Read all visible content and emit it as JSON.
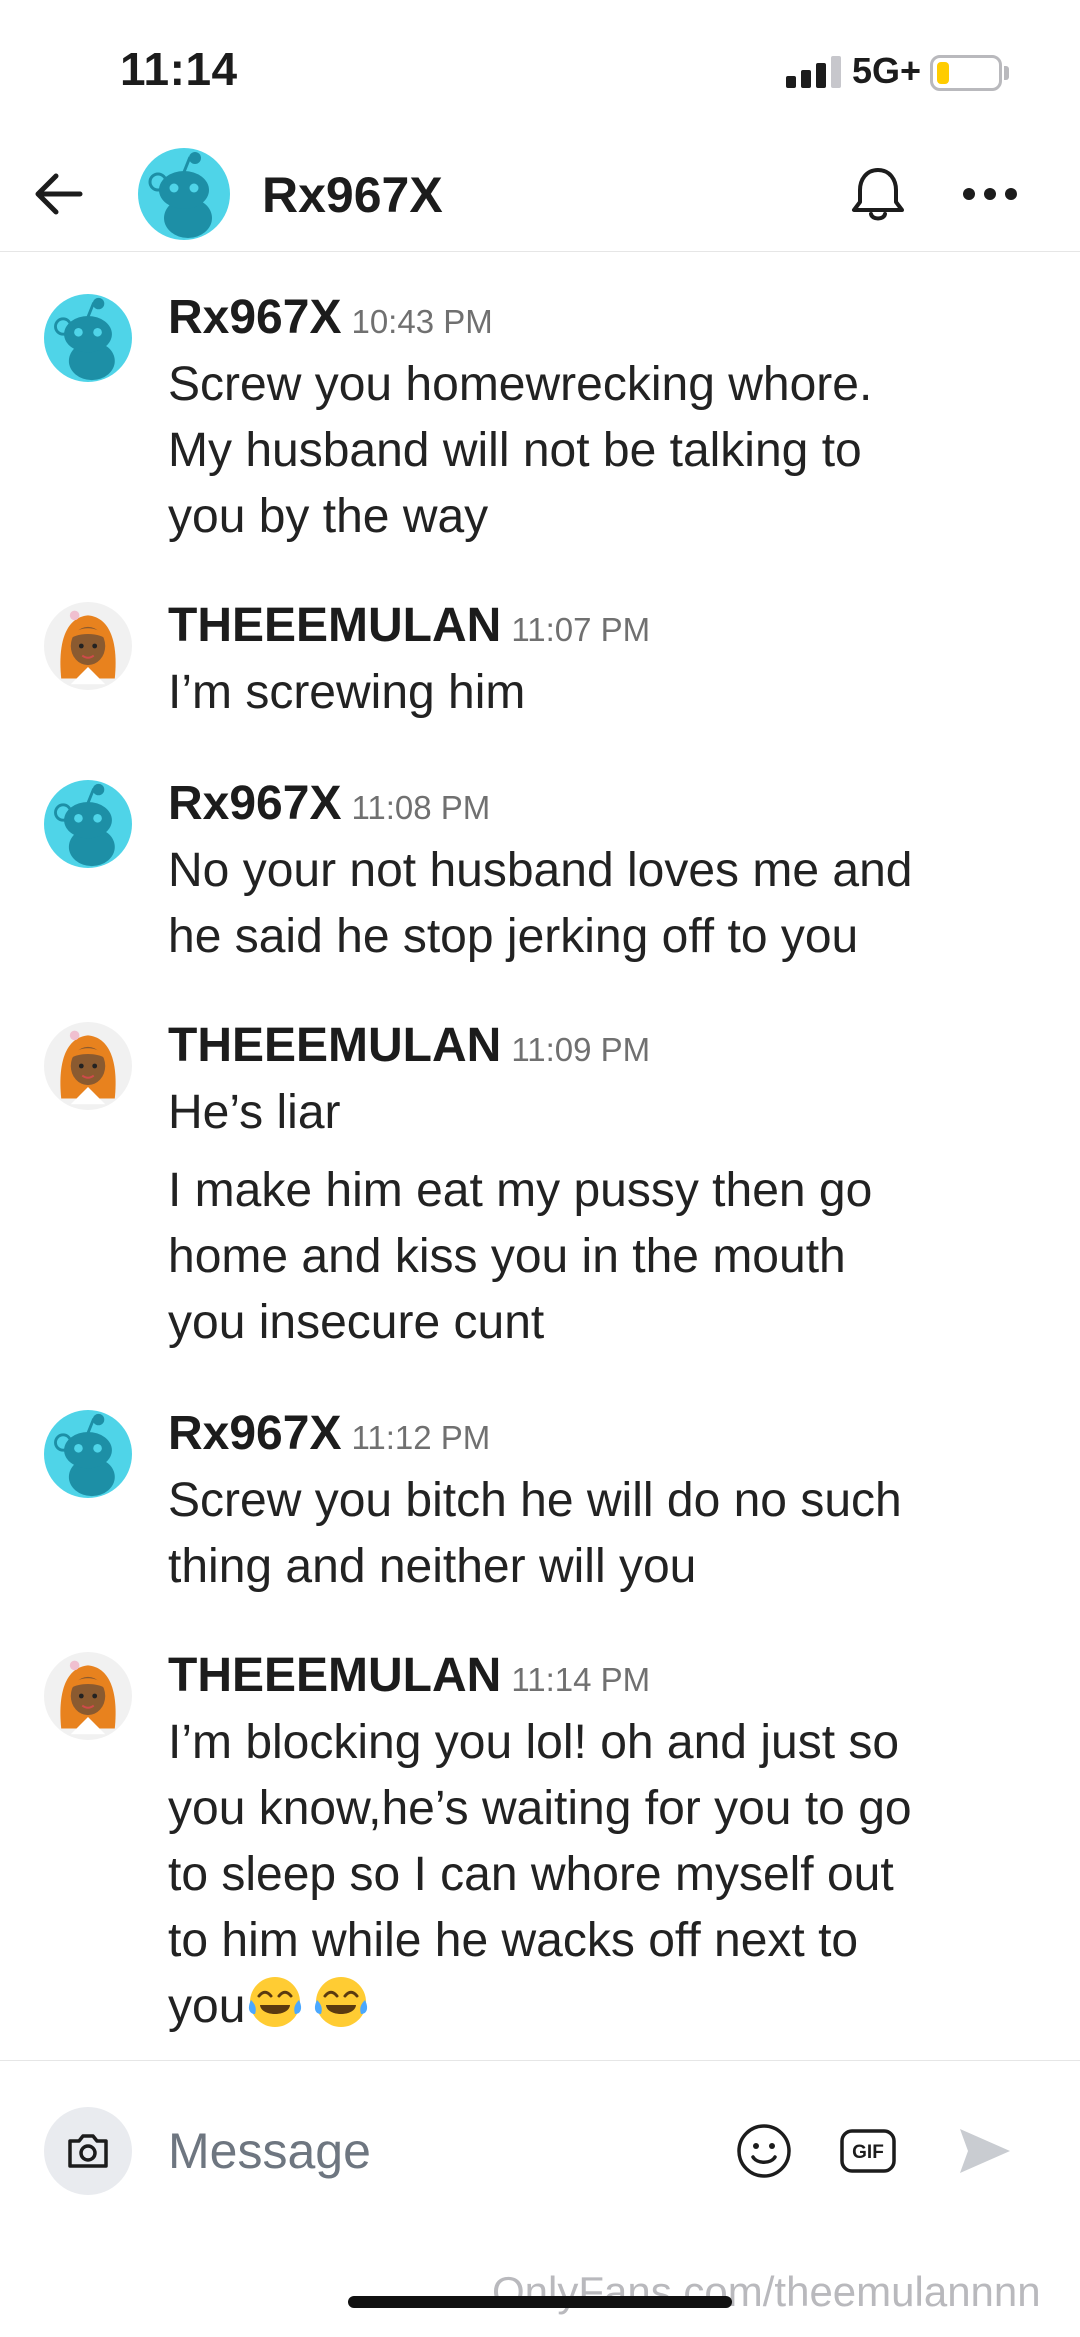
{
  "status_bar": {
    "time": "11:14",
    "network": "5G+",
    "signal_bars": 4,
    "signal_active": 3,
    "battery_level": 0.15,
    "battery_color": "#ffcc00"
  },
  "header": {
    "title": "Rx967X",
    "back_icon": "arrow-left-icon",
    "bell_icon": "bell-icon",
    "more_icon": "more-horizontal-icon"
  },
  "colors": {
    "reddit_avatar_bg": "#4fd4e8",
    "text_primary": "#1c1c1c",
    "text_secondary": "#707070"
  },
  "messages": [
    {
      "author": "Rx967X",
      "time": "10:43 PM",
      "avatar": "snoo-avatar",
      "texts": [
        "Screw you homewrecking whore.\nMy husband will not be talking to\nyou by the way"
      ]
    },
    {
      "author": "THEEEMULAN",
      "time": "11:07 PM",
      "avatar": "mulan-avatar",
      "texts": [
        "I’m screwing him"
      ]
    },
    {
      "author": "Rx967X",
      "time": "11:08 PM",
      "avatar": "snoo-avatar",
      "texts": [
        "No your not husband loves me and\nhe said he stop jerking off to you"
      ]
    },
    {
      "author": "THEEEMULAN",
      "time": "11:09 PM",
      "avatar": "mulan-avatar",
      "texts": [
        "He’s liar",
        "I make him eat my pussy then go\nhome and kiss you in the mouth\nyou insecure cunt"
      ]
    },
    {
      "author": "Rx967X",
      "time": "11:12 PM",
      "avatar": "snoo-avatar",
      "texts": [
        "Screw you bitch he will do no such\nthing and neither will you"
      ]
    },
    {
      "author": "THEEEMULAN",
      "time": "11:14 PM",
      "avatar": "mulan-avatar",
      "texts": [
        "I’m blocking you lol! oh and just so\nyou know,he’s waiting for you to go\nto sleep so I can whore myself out\nto him while he wacks off next to\nyou"
      ],
      "trailing_emoji": [
        "face-with-tears-of-joy-icon",
        "face-with-tears-of-joy-icon"
      ]
    }
  ],
  "composer": {
    "placeholder": "Message",
    "camera_icon": "camera-icon",
    "emoji_icon": "smiley-icon",
    "gif_label": "GIF",
    "send_icon": "send-icon"
  },
  "watermark": "OnlyFans.com/theemulannnn"
}
